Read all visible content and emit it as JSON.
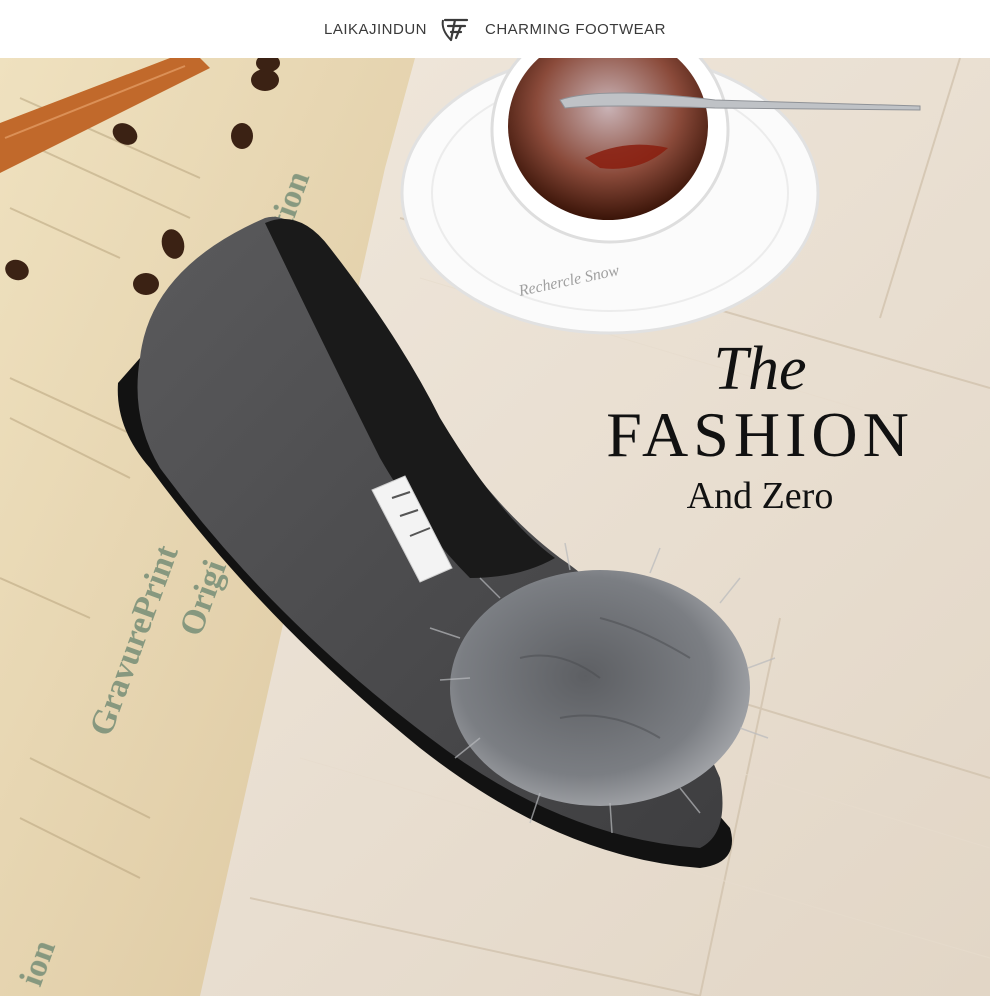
{
  "header": {
    "brand": "LAIKAJINDUN",
    "tagline": "CHARMING FOOTWEAR",
    "logo_icon": "stylized-leaf-logo-icon"
  },
  "headline": {
    "line1": "The",
    "line2": "FASHION",
    "line3": "And Zero"
  },
  "photo": {
    "subject": "gray suede flat shoe with fur pompom",
    "props_icons": [
      "coffee-cup-icon",
      "coffee-bean-icon",
      "newspaper-icon",
      "leather-strap-icon"
    ],
    "colors": {
      "shoe": "#4a4a4c",
      "fur": "#7a7c80",
      "floor": "#e9dfd2",
      "paper": "#e8d7b3"
    }
  }
}
